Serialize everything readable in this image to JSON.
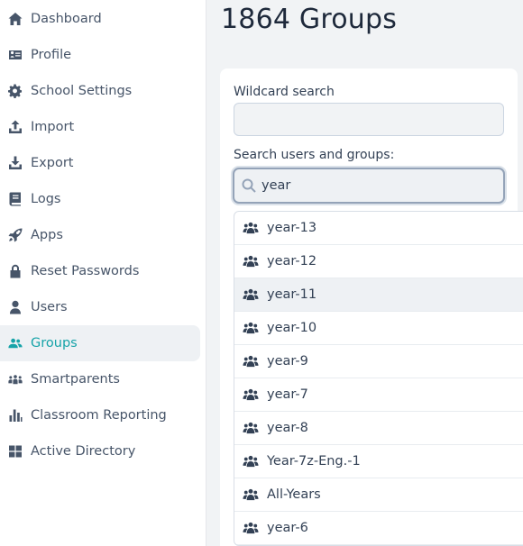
{
  "sidebar": {
    "items": [
      {
        "label": "Dashboard",
        "icon": "home-icon",
        "active": false
      },
      {
        "label": "Profile",
        "icon": "id-card-icon",
        "active": false
      },
      {
        "label": "School Settings",
        "icon": "gear-icon",
        "active": false
      },
      {
        "label": "Import",
        "icon": "upload-icon",
        "active": false
      },
      {
        "label": "Export",
        "icon": "download-icon",
        "active": false
      },
      {
        "label": "Logs",
        "icon": "book-icon",
        "active": false
      },
      {
        "label": "Apps",
        "icon": "rocket-icon",
        "active": false
      },
      {
        "label": "Reset Passwords",
        "icon": "lock-icon",
        "active": false
      },
      {
        "label": "Users",
        "icon": "user-icon",
        "active": false
      },
      {
        "label": "Groups",
        "icon": "users-icon",
        "active": true
      },
      {
        "label": "Smartparents",
        "icon": "people-group-icon",
        "active": false
      },
      {
        "label": "Classroom Reporting",
        "icon": "bar-chart-icon",
        "active": false
      },
      {
        "label": "Active Directory",
        "icon": "windows-icon",
        "active": false
      }
    ]
  },
  "main": {
    "title": "1864 Groups",
    "wildcard_label": "Wildcard search",
    "wildcard_value": "",
    "search_label": "Search users and groups:",
    "search_value": "year"
  },
  "dropdown": {
    "items": [
      {
        "label": "year-13",
        "icon": "users-icon"
      },
      {
        "label": "year-12",
        "icon": "users-icon"
      },
      {
        "label": "year-11",
        "icon": "users-icon"
      },
      {
        "label": "year-10",
        "icon": "users-icon"
      },
      {
        "label": "year-9",
        "icon": "users-icon"
      },
      {
        "label": "year-7",
        "icon": "users-icon"
      },
      {
        "label": "year-8",
        "icon": "users-icon"
      },
      {
        "label": "Year-7z-Eng.-1",
        "icon": "users-icon"
      },
      {
        "label": "All-Years",
        "icon": "users-icon"
      },
      {
        "label": "year-6",
        "icon": "users-icon"
      }
    ],
    "highlighted": "year-11"
  },
  "colors": {
    "accent": "#16a3a8",
    "text": "#334155",
    "background": "#f1f3f5"
  }
}
